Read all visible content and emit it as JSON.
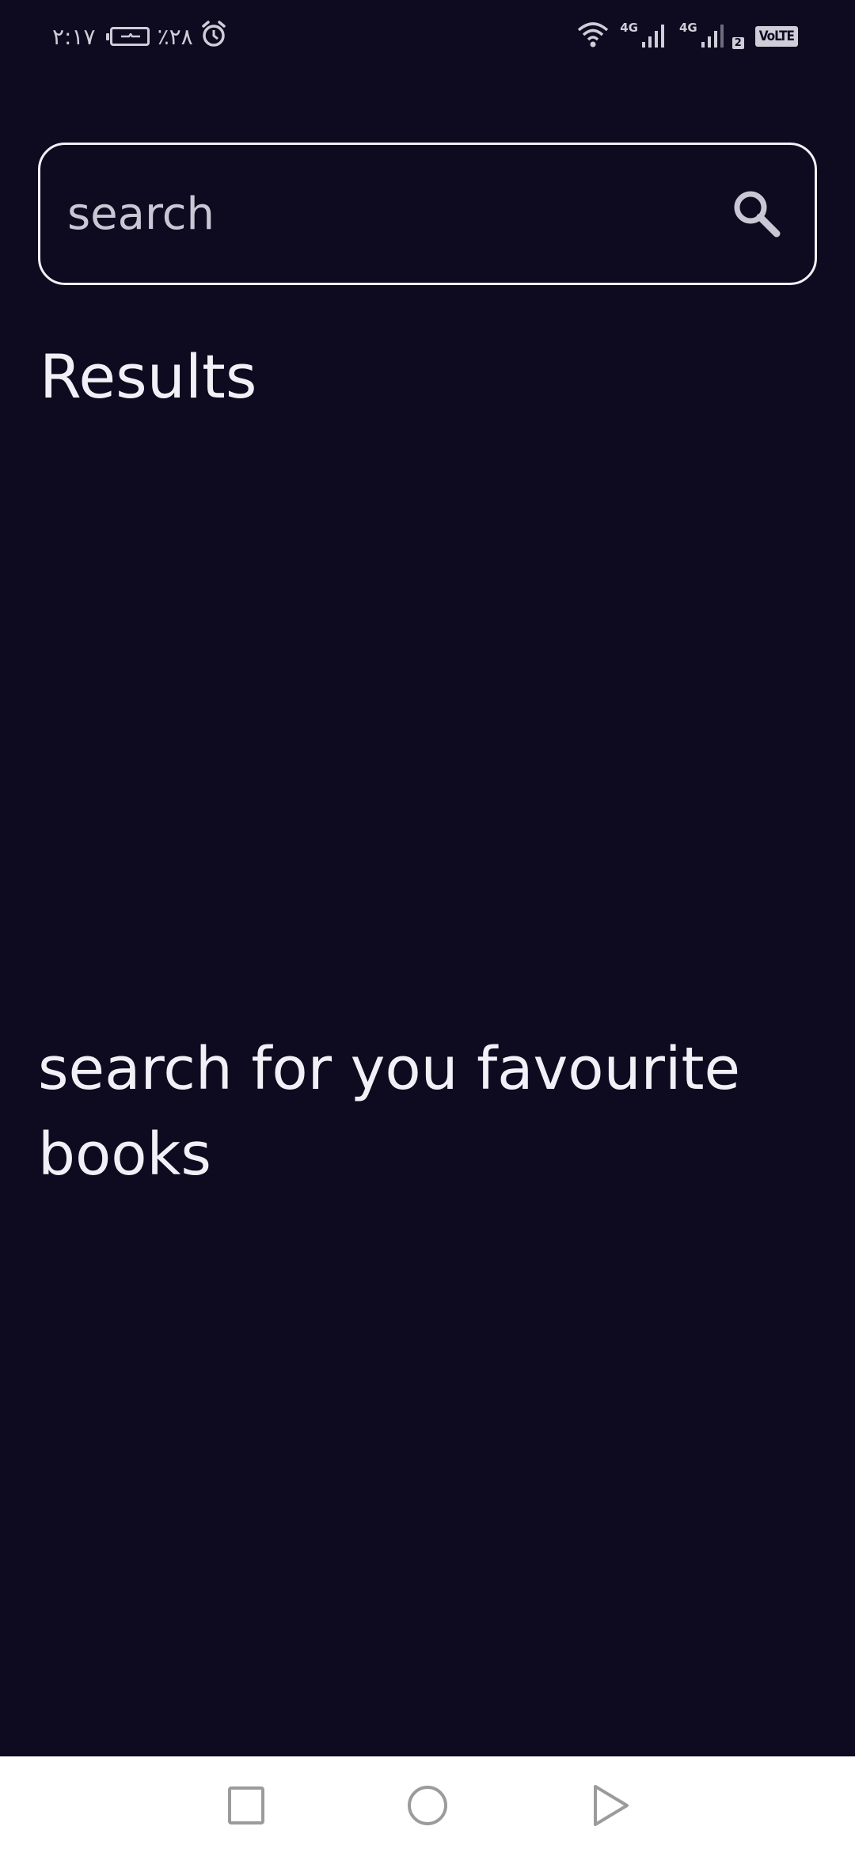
{
  "status_bar": {
    "time": "٢:١٧",
    "battery_percent": "٪٢٨",
    "network_1": "4G",
    "network_2": "4G",
    "sim_slot": "2",
    "volte": "VoLTE",
    "icons": [
      "alarm-icon",
      "wifi-icon",
      "signal-icon",
      "battery-icon"
    ]
  },
  "search": {
    "placeholder": "search",
    "value": ""
  },
  "results": {
    "title": "Results",
    "empty_message": "search for you favourite books"
  },
  "nav_bar": {
    "buttons": [
      "recents",
      "home",
      "back"
    ]
  },
  "colors": {
    "background": "#0e0b20",
    "text": "#f2f0f7",
    "placeholder": "#c9c7d4",
    "nav_background": "#ffffff"
  }
}
